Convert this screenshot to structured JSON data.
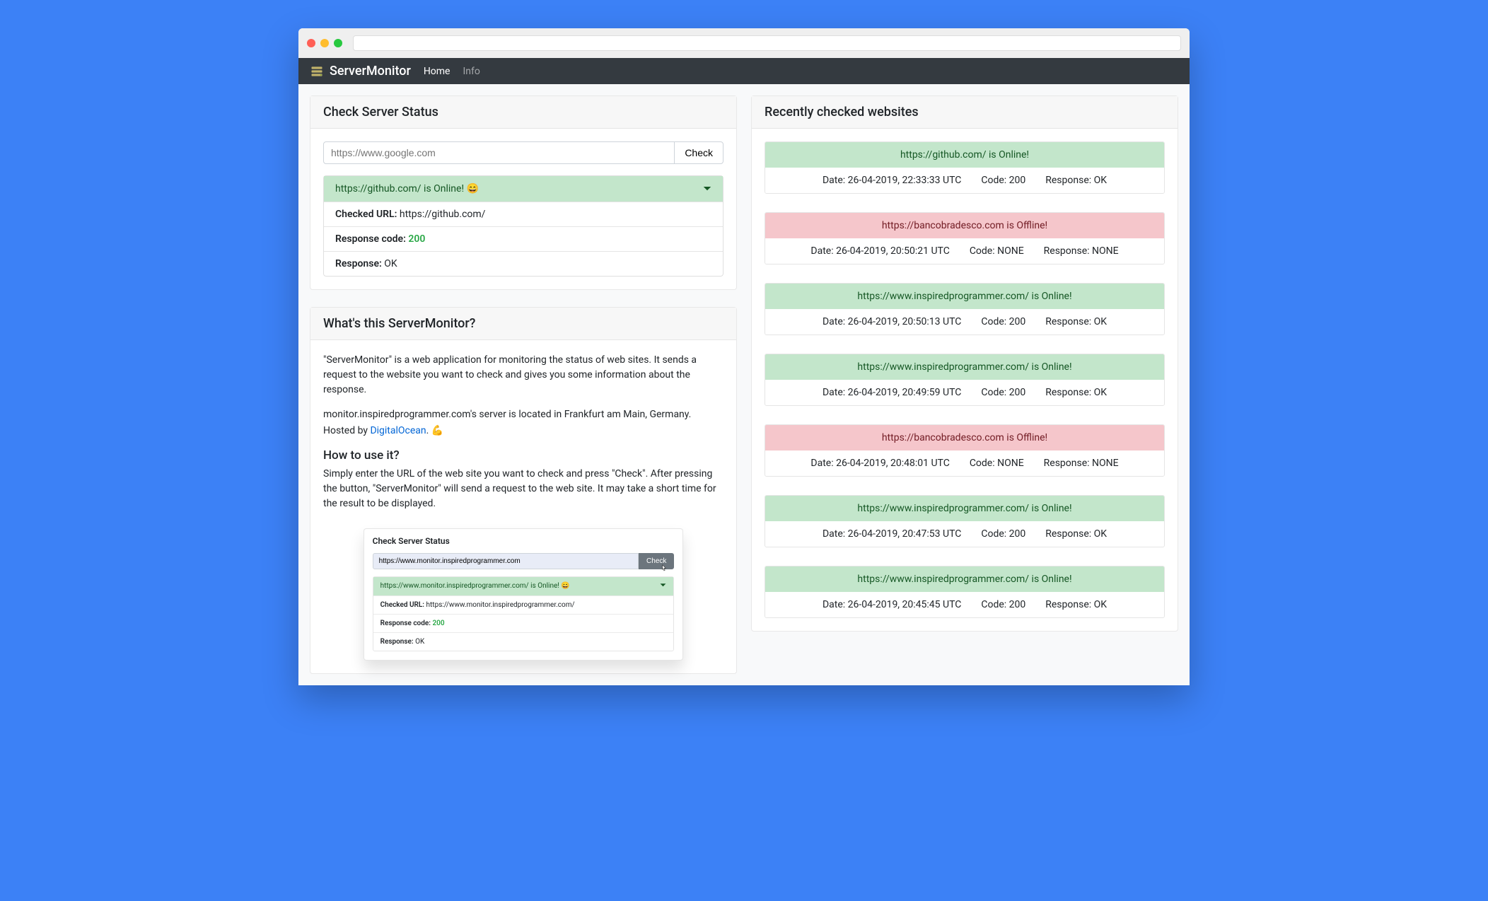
{
  "nav": {
    "brand": "ServerMonitor",
    "home": "Home",
    "info": "Info"
  },
  "check_card": {
    "title": "Check Server Status",
    "placeholder": "https://www.google.com",
    "button": "Check",
    "result_title": "https://github.com/ is Online! 😄",
    "checked_url_label": "Checked URL:",
    "checked_url_value": " https://github.com/",
    "code_label": "Response code: ",
    "code_value": "200",
    "response_label": "Response:",
    "response_value": " OK"
  },
  "about": {
    "title": "What's this ServerMonitor?",
    "p1": "\"ServerMonitor\" is a web application for monitoring the status of web sites. It sends a request to the website you want to check and gives you some information about the response.",
    "p2": "monitor.inspiredprogrammer.com's server is located in Frankfurt am Main, Germany.",
    "hosted_prefix": "Hosted by ",
    "hosted_link": "DigitalOcean",
    "hosted_suffix": ". 💪",
    "how_title": "How to use it?",
    "how_text": "Simply enter the URL of the web site you want to check and press \"Check\". After pressing the button, \"ServerMonitor\" will send a request to the web site. It may take a short time for the result to be displayed."
  },
  "demo": {
    "header": "Check Server Status",
    "input_value": "https://www.monitor.inspiredprogrammer.com",
    "button": "Check",
    "acc_title": "https://www.monitor.inspiredprogrammer.com/ is Online! 😄",
    "row1_label": "Checked URL:",
    "row1_value": " https://www.monitor.inspiredprogrammer.com/",
    "row2_label": "Response code: ",
    "row2_value": "200",
    "row3_label": "Response:",
    "row3_value": " OK"
  },
  "recent": {
    "title": "Recently checked websites",
    "items": [
      {
        "status": "online",
        "headline": "https://github.com/ is Online!",
        "date": "Date: 26-04-2019, 22:33:33 UTC",
        "code": "Code: 200",
        "response": "Response: OK"
      },
      {
        "status": "offline",
        "headline": "https://bancobradesco.com is Offline!",
        "date": "Date: 26-04-2019, 20:50:21 UTC",
        "code": "Code: NONE",
        "response": "Response: NONE"
      },
      {
        "status": "online",
        "headline": "https://www.inspiredprogrammer.com/ is Online!",
        "date": "Date: 26-04-2019, 20:50:13 UTC",
        "code": "Code: 200",
        "response": "Response: OK"
      },
      {
        "status": "online",
        "headline": "https://www.inspiredprogrammer.com/ is Online!",
        "date": "Date: 26-04-2019, 20:49:59 UTC",
        "code": "Code: 200",
        "response": "Response: OK"
      },
      {
        "status": "offline",
        "headline": "https://bancobradesco.com is Offline!",
        "date": "Date: 26-04-2019, 20:48:01 UTC",
        "code": "Code: NONE",
        "response": "Response: NONE"
      },
      {
        "status": "online",
        "headline": "https://www.inspiredprogrammer.com/ is Online!",
        "date": "Date: 26-04-2019, 20:47:53 UTC",
        "code": "Code: 200",
        "response": "Response: OK"
      },
      {
        "status": "online",
        "headline": "https://www.inspiredprogrammer.com/ is Online!",
        "date": "Date: 26-04-2019, 20:45:45 UTC",
        "code": "Code: 200",
        "response": "Response: OK"
      }
    ]
  }
}
